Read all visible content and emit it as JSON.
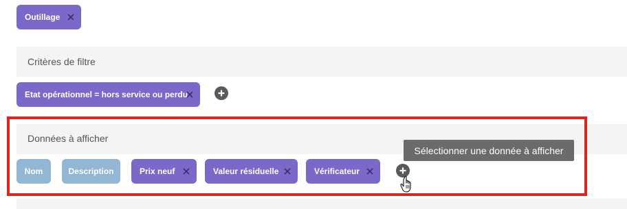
{
  "top_chips": [
    {
      "label": "Outillage"
    }
  ],
  "filter_section": {
    "title": "Critères de filtre",
    "chips": [
      {
        "label": "Etat opérationnel = hors service ou perdu"
      }
    ]
  },
  "display_section": {
    "title": "Données à afficher",
    "chips": [
      {
        "label": "Nom",
        "style": "blue"
      },
      {
        "label": "Description",
        "style": "blue"
      },
      {
        "label": "Prix neuf",
        "style": "purple"
      },
      {
        "label": "Valeur résiduelle",
        "style": "purple"
      },
      {
        "label": "Vérificateur",
        "style": "purple"
      }
    ],
    "tooltip": "Sélectionner une donnée à afficher"
  },
  "icons": {
    "close": "close-icon",
    "add": "plus-icon",
    "cursor": "hand-pointer-icon"
  },
  "colors": {
    "chip_purple": "#7b68c8",
    "chip_blue": "#92b6d4",
    "highlight_red": "#e2231a",
    "tooltip_bg": "#6b6b6b"
  }
}
